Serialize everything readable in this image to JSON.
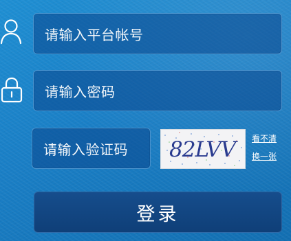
{
  "form": {
    "account": {
      "icon": "user-icon",
      "placeholder": "请输入平台帐号"
    },
    "password": {
      "icon": "lock-icon",
      "placeholder": "请输入密码"
    },
    "captcha": {
      "placeholder": "请输入验证码",
      "code": "82LVV",
      "unclear_label": "看不清",
      "refresh_label": "换一张"
    },
    "login_label": "登录"
  },
  "colors": {
    "background": "#1a7fc6",
    "field_background": "#0f4e93",
    "button_background": "#12467f",
    "text": "#ffffff"
  }
}
